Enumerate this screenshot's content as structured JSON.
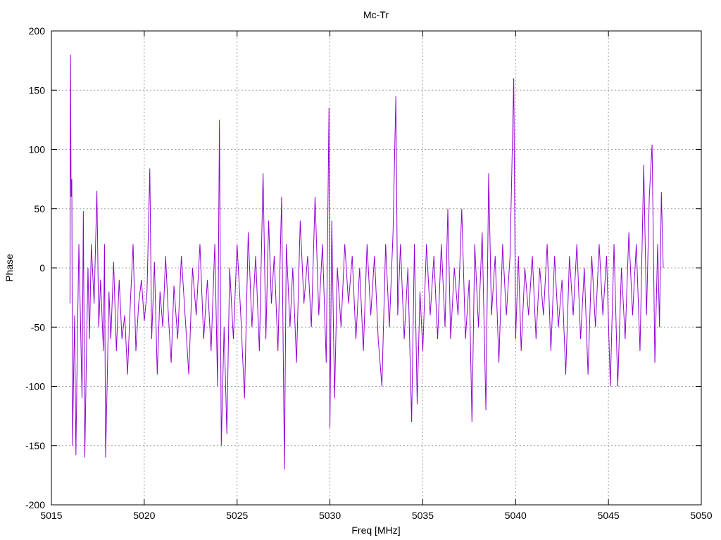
{
  "chart_data": {
    "type": "line",
    "title": "Mc-Tr",
    "xlabel": "Freq [MHz]",
    "ylabel": "Phase",
    "xlim": [
      5015,
      5050
    ],
    "ylim": [
      -200,
      200
    ],
    "xticks": [
      "5015",
      "5020",
      "5025",
      "5030",
      "5035",
      "5040",
      "5045",
      "5050"
    ],
    "yticks": [
      "200",
      "150",
      "100",
      "50",
      "0",
      "-50",
      "-100",
      "-150",
      "-200"
    ],
    "grid": true,
    "legend": "none",
    "series": [
      {
        "color": "#9400d3",
        "x_start": 5016,
        "x_end": 5048,
        "points": [
          [
            5016.0,
            -30
          ],
          [
            5016.03,
            180
          ],
          [
            5016.06,
            60
          ],
          [
            5016.1,
            75
          ],
          [
            5016.14,
            -150
          ],
          [
            5016.18,
            -105
          ],
          [
            5016.25,
            -40
          ],
          [
            5016.32,
            -158
          ],
          [
            5016.4,
            -60
          ],
          [
            5016.48,
            20
          ],
          [
            5016.56,
            -40
          ],
          [
            5016.65,
            -110
          ],
          [
            5016.72,
            48
          ],
          [
            5016.8,
            -160
          ],
          [
            5016.88,
            -80
          ],
          [
            5016.97,
            0
          ],
          [
            5017.05,
            -60
          ],
          [
            5017.15,
            20
          ],
          [
            5017.3,
            -30
          ],
          [
            5017.45,
            65
          ],
          [
            5017.55,
            -50
          ],
          [
            5017.65,
            -10
          ],
          [
            5017.8,
            -70
          ],
          [
            5017.86,
            20
          ],
          [
            5017.92,
            -160
          ],
          [
            5018.0,
            -100
          ],
          [
            5018.1,
            -20
          ],
          [
            5018.2,
            -60
          ],
          [
            5018.35,
            5
          ],
          [
            5018.5,
            -70
          ],
          [
            5018.65,
            -10
          ],
          [
            5018.8,
            -60
          ],
          [
            5018.95,
            -40
          ],
          [
            5019.1,
            -90
          ],
          [
            5019.25,
            -30
          ],
          [
            5019.4,
            20
          ],
          [
            5019.55,
            -70
          ],
          [
            5019.7,
            -30
          ],
          [
            5019.85,
            -10
          ],
          [
            5020.0,
            -45
          ],
          [
            5020.15,
            -20
          ],
          [
            5020.3,
            84
          ],
          [
            5020.4,
            -60
          ],
          [
            5020.55,
            5
          ],
          [
            5020.7,
            -90
          ],
          [
            5020.85,
            -20
          ],
          [
            5021.0,
            -50
          ],
          [
            5021.15,
            10
          ],
          [
            5021.3,
            -40
          ],
          [
            5021.45,
            -80
          ],
          [
            5021.6,
            -15
          ],
          [
            5021.8,
            -60
          ],
          [
            5022.0,
            10
          ],
          [
            5022.2,
            -40
          ],
          [
            5022.4,
            -90
          ],
          [
            5022.6,
            0
          ],
          [
            5022.8,
            -40
          ],
          [
            5023.0,
            20
          ],
          [
            5023.2,
            -60
          ],
          [
            5023.4,
            -10
          ],
          [
            5023.6,
            -70
          ],
          [
            5023.8,
            20
          ],
          [
            5023.95,
            -100
          ],
          [
            5024.05,
            125
          ],
          [
            5024.15,
            -150
          ],
          [
            5024.3,
            -50
          ],
          [
            5024.45,
            -140
          ],
          [
            5024.6,
            0
          ],
          [
            5024.8,
            -60
          ],
          [
            5025.0,
            20
          ],
          [
            5025.2,
            -40
          ],
          [
            5025.4,
            -110
          ],
          [
            5025.6,
            30
          ],
          [
            5025.8,
            -50
          ],
          [
            5026.0,
            10
          ],
          [
            5026.2,
            -70
          ],
          [
            5026.4,
            80
          ],
          [
            5026.55,
            -60
          ],
          [
            5026.7,
            40
          ],
          [
            5026.85,
            -30
          ],
          [
            5027.0,
            10
          ],
          [
            5027.2,
            -70
          ],
          [
            5027.4,
            60
          ],
          [
            5027.55,
            -170
          ],
          [
            5027.65,
            20
          ],
          [
            5027.85,
            -50
          ],
          [
            5028.0,
            0
          ],
          [
            5028.2,
            -80
          ],
          [
            5028.4,
            40
          ],
          [
            5028.6,
            -30
          ],
          [
            5028.8,
            10
          ],
          [
            5029.0,
            -50
          ],
          [
            5029.2,
            60
          ],
          [
            5029.4,
            -40
          ],
          [
            5029.6,
            20
          ],
          [
            5029.8,
            -80
          ],
          [
            5029.95,
            135
          ],
          [
            5030.0,
            -135
          ],
          [
            5030.1,
            40
          ],
          [
            5030.25,
            -110
          ],
          [
            5030.4,
            0
          ],
          [
            5030.6,
            -50
          ],
          [
            5030.8,
            20
          ],
          [
            5031.0,
            -30
          ],
          [
            5031.2,
            10
          ],
          [
            5031.4,
            -60
          ],
          [
            5031.6,
            0
          ],
          [
            5031.8,
            -70
          ],
          [
            5032.0,
            20
          ],
          [
            5032.2,
            -40
          ],
          [
            5032.4,
            10
          ],
          [
            5032.6,
            -60
          ],
          [
            5032.8,
            -100
          ],
          [
            5033.0,
            20
          ],
          [
            5033.2,
            -50
          ],
          [
            5033.4,
            30
          ],
          [
            5033.55,
            145
          ],
          [
            5033.65,
            -40
          ],
          [
            5033.8,
            20
          ],
          [
            5034.0,
            -60
          ],
          [
            5034.2,
            0
          ],
          [
            5034.4,
            -130
          ],
          [
            5034.55,
            20
          ],
          [
            5034.7,
            -115
          ],
          [
            5034.85,
            -20
          ],
          [
            5035.0,
            -70
          ],
          [
            5035.2,
            20
          ],
          [
            5035.4,
            -40
          ],
          [
            5035.6,
            10
          ],
          [
            5035.8,
            -60
          ],
          [
            5036.0,
            20
          ],
          [
            5036.2,
            -50
          ],
          [
            5036.35,
            50
          ],
          [
            5036.5,
            -60
          ],
          [
            5036.7,
            0
          ],
          [
            5036.9,
            -40
          ],
          [
            5037.1,
            50
          ],
          [
            5037.3,
            -60
          ],
          [
            5037.5,
            -10
          ],
          [
            5037.65,
            -130
          ],
          [
            5037.8,
            20
          ],
          [
            5038.0,
            -50
          ],
          [
            5038.2,
            30
          ],
          [
            5038.4,
            -120
          ],
          [
            5038.55,
            80
          ],
          [
            5038.7,
            -40
          ],
          [
            5038.9,
            10
          ],
          [
            5039.1,
            -80
          ],
          [
            5039.3,
            20
          ],
          [
            5039.5,
            -40
          ],
          [
            5039.7,
            10
          ],
          [
            5039.9,
            160
          ],
          [
            5040.0,
            -60
          ],
          [
            5040.15,
            10
          ],
          [
            5040.3,
            -70
          ],
          [
            5040.5,
            0
          ],
          [
            5040.7,
            -40
          ],
          [
            5040.9,
            10
          ],
          [
            5041.1,
            -60
          ],
          [
            5041.3,
            0
          ],
          [
            5041.5,
            -40
          ],
          [
            5041.7,
            20
          ],
          [
            5041.9,
            -70
          ],
          [
            5042.1,
            10
          ],
          [
            5042.3,
            -50
          ],
          [
            5042.5,
            -10
          ],
          [
            5042.7,
            -90
          ],
          [
            5042.9,
            10
          ],
          [
            5043.1,
            -40
          ],
          [
            5043.3,
            20
          ],
          [
            5043.5,
            -60
          ],
          [
            5043.7,
            0
          ],
          [
            5043.9,
            -90
          ],
          [
            5044.1,
            10
          ],
          [
            5044.3,
            -50
          ],
          [
            5044.5,
            20
          ],
          [
            5044.7,
            -40
          ],
          [
            5044.9,
            10
          ],
          [
            5045.1,
            -100
          ],
          [
            5045.3,
            20
          ],
          [
            5045.5,
            -100
          ],
          [
            5045.7,
            0
          ],
          [
            5045.9,
            -60
          ],
          [
            5046.1,
            30
          ],
          [
            5046.3,
            -40
          ],
          [
            5046.5,
            20
          ],
          [
            5046.7,
            -70
          ],
          [
            5046.9,
            87
          ],
          [
            5047.05,
            -40
          ],
          [
            5047.2,
            60
          ],
          [
            5047.35,
            104
          ],
          [
            5047.5,
            -80
          ],
          [
            5047.65,
            20
          ],
          [
            5047.75,
            -50
          ],
          [
            5047.85,
            64
          ],
          [
            5047.95,
            0
          ]
        ]
      }
    ]
  }
}
